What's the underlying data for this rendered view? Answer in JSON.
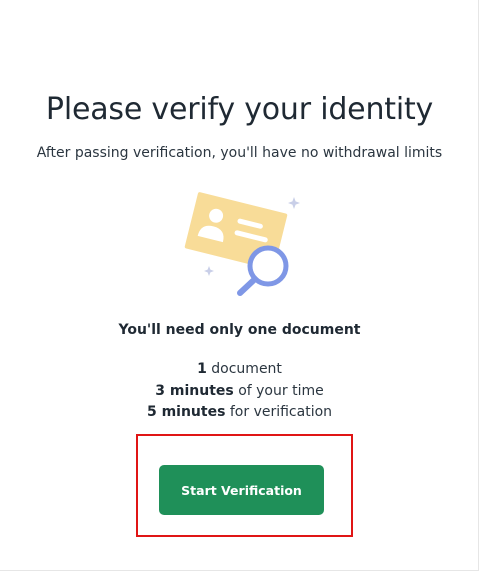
{
  "page": {
    "title": "Please verify your identity",
    "subtitle": "After passing verification, you'll have no withdrawal limits"
  },
  "illustration": {
    "icon": "id-card-magnifier-icon",
    "card_color": "#f8dc98",
    "lens_color": "#7f97e6",
    "sparkle_color": "#c9cfe8"
  },
  "requirements": {
    "heading": "You'll need only one document",
    "items": [
      {
        "strong": "1",
        "rest": " document"
      },
      {
        "strong": "3 minutes",
        "rest": " of your time"
      },
      {
        "strong": "5 minutes",
        "rest": " for verification"
      }
    ]
  },
  "action": {
    "start_label": "Start Verification",
    "button_color": "#1f9059",
    "highlight_color": "#e01515"
  }
}
